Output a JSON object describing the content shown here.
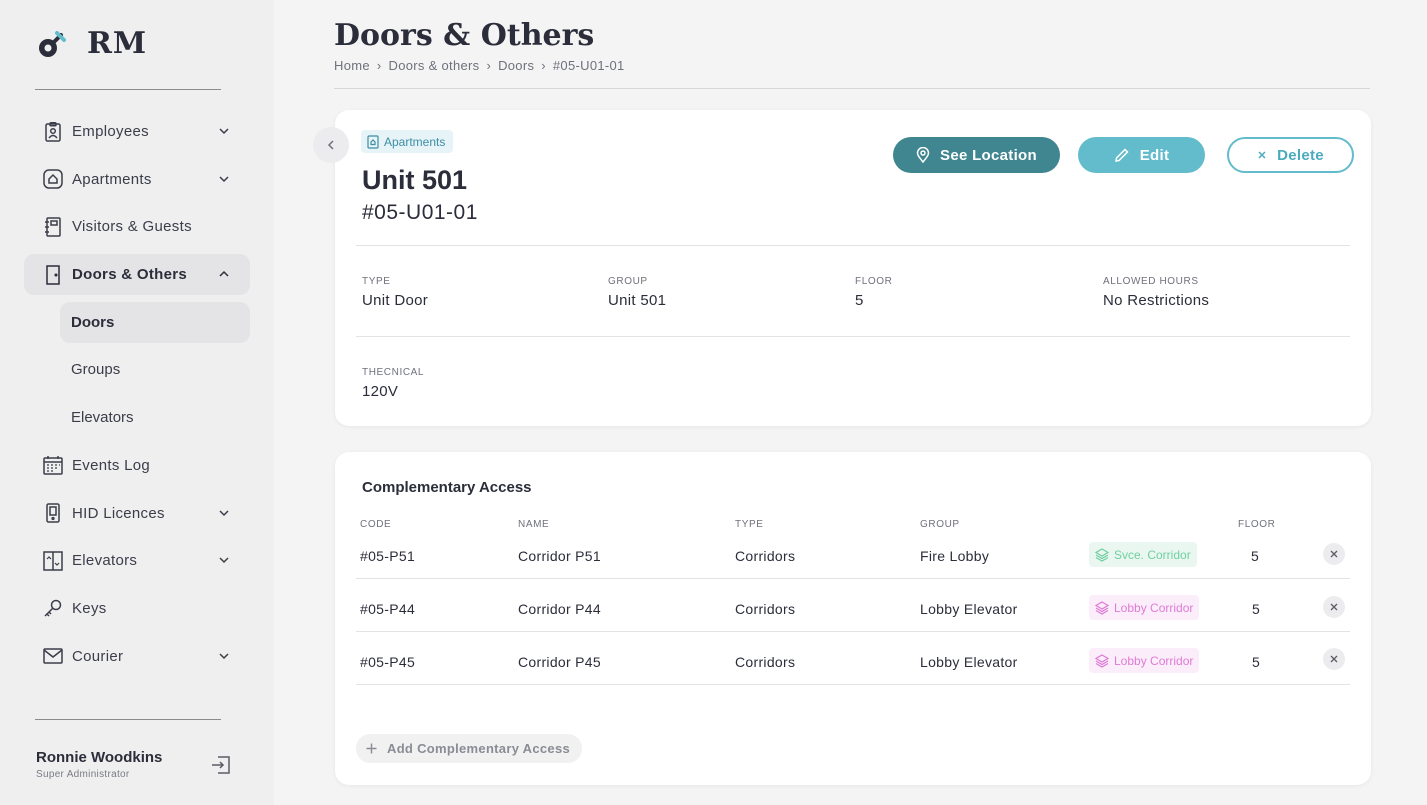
{
  "app": {
    "logo_text": "RM"
  },
  "sidebar": {
    "items": [
      {
        "label": "Employees",
        "icon": "id-badge-icon"
      },
      {
        "label": "Apartments",
        "icon": "house-icon"
      },
      {
        "label": "Visitors & Guests",
        "icon": "notebook-icon"
      },
      {
        "label": "Doors & Others",
        "icon": "door-icon"
      },
      {
        "label": "Events Log",
        "icon": "calendar-icon"
      },
      {
        "label": "HID Licences",
        "icon": "card-reader-icon"
      },
      {
        "label": "Elevators",
        "icon": "elevator-icon"
      },
      {
        "label": "Keys",
        "icon": "key-icon"
      },
      {
        "label": "Courier",
        "icon": "mail-icon"
      }
    ],
    "subitems": [
      {
        "label": "Doors"
      },
      {
        "label": "Groups"
      },
      {
        "label": "Elevators"
      }
    ]
  },
  "user": {
    "name": "Ronnie Woodkins",
    "role": "Super Administrator"
  },
  "page": {
    "title": "Doors & Others",
    "breadcrumb": [
      "Home",
      "Doors & others",
      "Doors",
      "#05-U01-01"
    ]
  },
  "detail": {
    "tag": "Apartments",
    "title": "Unit 501",
    "code": "#05-U01-01",
    "buttons": {
      "location": "See Location",
      "edit": "Edit",
      "delete": "Delete"
    },
    "fields": {
      "type_label": "TYPE",
      "type_value": "Unit Door",
      "group_label": "GROUP",
      "group_value": "Unit 501",
      "floor_label": "FLOOR",
      "floor_value": "5",
      "hours_label": "ALLOWED HOURS",
      "hours_value": "No Restrictions",
      "technical_label": "THECNICAL",
      "technical_value": "120V"
    }
  },
  "access": {
    "title": "Complementary Access",
    "headers": {
      "code": "CODE",
      "name": "NAME",
      "type": "TYPE",
      "group": "GROUP",
      "floor": "FLOOR"
    },
    "rows": [
      {
        "code": "#05-P51",
        "name": "Corridor P51",
        "type": "Corridors",
        "group": "Fire Lobby",
        "badge": "Svce. Corridor",
        "badge_color": "#6fcf9f",
        "floor": "5"
      },
      {
        "code": "#05-P44",
        "name": "Corridor P44",
        "type": "Corridors",
        "group": "Lobby Elevator",
        "badge": "Lobby Corridor",
        "badge_color": "#e07ad6",
        "floor": "5"
      },
      {
        "code": "#05-P45",
        "name": "Corridor P45",
        "type": "Corridors",
        "group": "Lobby Elevator",
        "badge": "Lobby Corridor",
        "badge_color": "#e07ad6",
        "floor": "5"
      }
    ],
    "add_label": "Add Complementary Access"
  },
  "colors": {
    "primary": "#3f8690",
    "accent": "#62bccb",
    "text": "#2b2d3a"
  }
}
